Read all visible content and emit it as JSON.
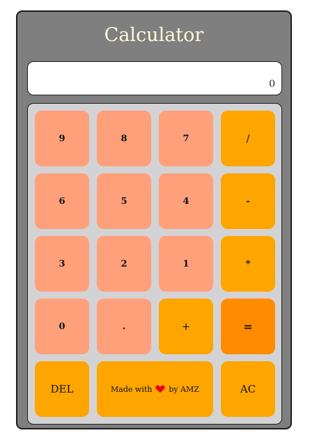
{
  "app": {
    "title": "Calculator"
  },
  "display": {
    "value": "0"
  },
  "keys": {
    "k9": "9",
    "k8": "8",
    "k7": "7",
    "div": "/",
    "k6": "6",
    "k5": "5",
    "k4": "4",
    "sub": "-",
    "k3": "3",
    "k2": "2",
    "k1": "1",
    "mul": "*",
    "k0": "0",
    "dot": ".",
    "add": "+",
    "eq": "=",
    "del": "DEL",
    "ac": "AC"
  },
  "credit": {
    "prefix": "Made with",
    "suffix": "by AMZ",
    "icon": "heart-icon"
  },
  "colors": {
    "number_key": "#ffa07a",
    "operator_key": "#ffa500",
    "equals_key": "#ff8c00",
    "title": "#fff8dc",
    "frame": "#7f7f7f",
    "keypad": "#d3d3d5",
    "heart": "#e8000b"
  }
}
